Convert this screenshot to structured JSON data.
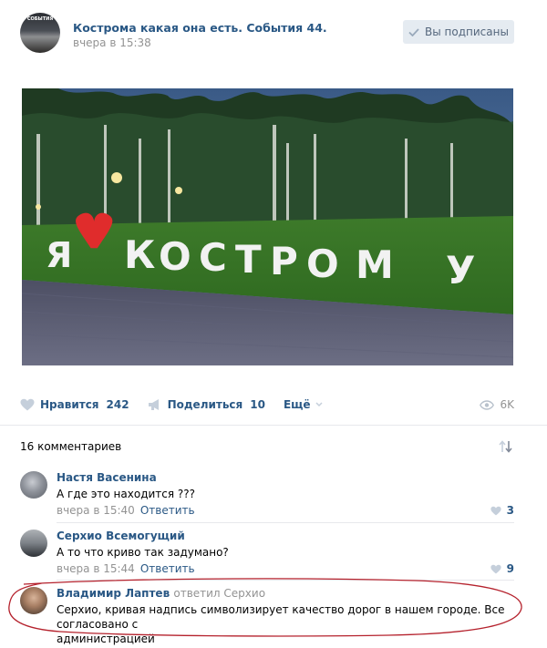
{
  "post": {
    "group_name": "Кострома какая она есть. События 44.",
    "date": "вчера в 15:38",
    "subscribed_label": "Вы подписаны",
    "avatar_caption": "СОБЫТИЯ",
    "photo_sign_text": "Я ♥ КОСТРОМУ"
  },
  "actions": {
    "like_label": "Нравится",
    "like_count": "242",
    "share_label": "Поделиться",
    "share_count": "10",
    "more_label": "Ещё",
    "views": "6K"
  },
  "comments_header": {
    "count_label": "16 комментариев"
  },
  "comments": [
    {
      "author": "Настя Васенина",
      "text": "А где это находится ???",
      "date": "вчера в 15:40",
      "reply_label": "Ответить",
      "likes": "3"
    },
    {
      "author": "Серхио Всемогущий",
      "text": "А то что криво так задумано?",
      "date": "вчера в 15:44",
      "reply_label": "Ответить",
      "likes": "9"
    },
    {
      "author": "Владимир Лаптев",
      "replied_to": "ответил Серхио",
      "text_line1": "Серхио, кривая надпись символизирует качество дорог в нашем городе. Все согласовано с",
      "text_line2": "администрацией"
    }
  ],
  "icons": {
    "like": "heart-icon",
    "share": "megaphone-icon",
    "more": "chevron-down-icon",
    "views": "eye-icon",
    "sort": "sort-arrows-icon",
    "subscribed": "check-icon"
  },
  "colors": {
    "link": "#2a5885",
    "muted": "#939393",
    "button_bg": "#e5ebf1",
    "highlight": "#b5222d",
    "heart": "#e02c2c"
  }
}
